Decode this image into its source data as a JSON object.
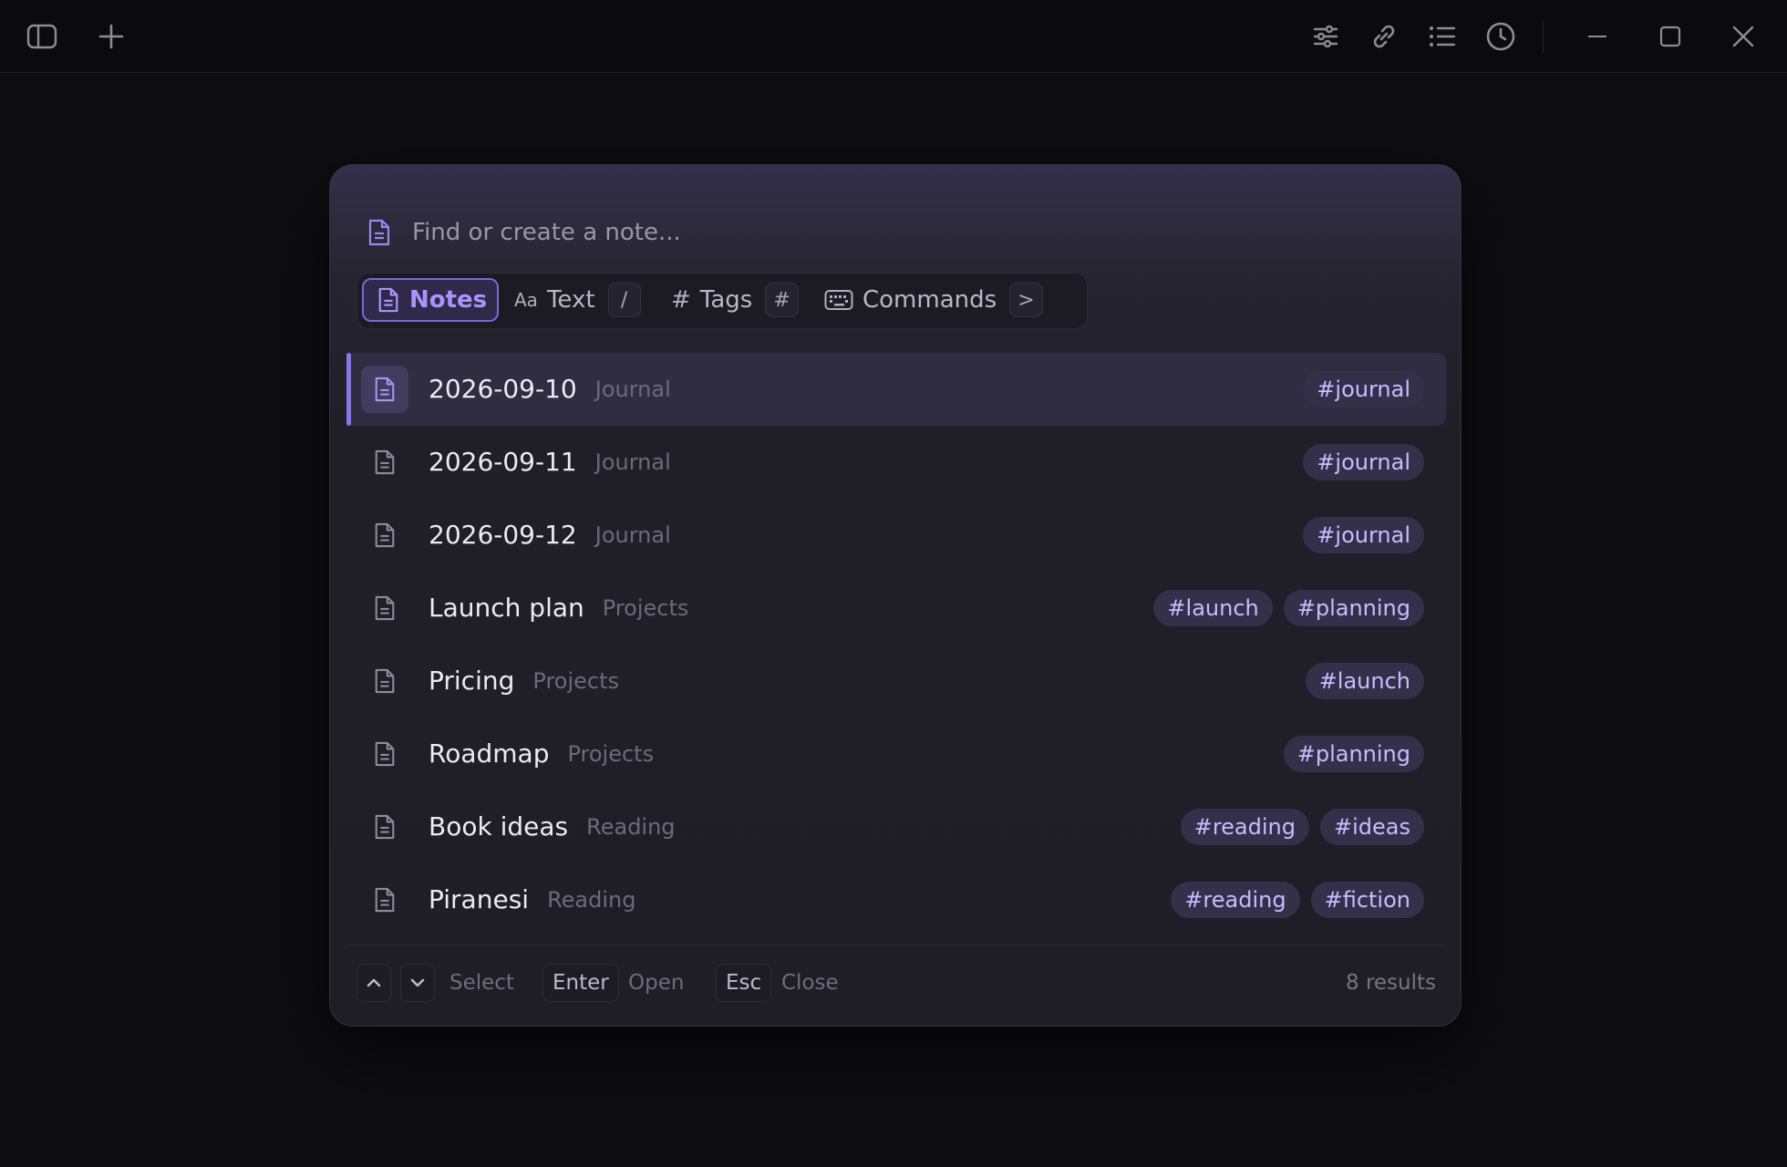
{
  "toolbar": {
    "left_icons": [
      "sidebar-toggle-icon",
      "plus-icon"
    ],
    "right_icons": [
      "sliders-icon",
      "link-icon",
      "list-icon",
      "clock-icon"
    ],
    "window_controls": [
      "minimize-icon",
      "maximize-icon",
      "close-icon"
    ]
  },
  "search": {
    "placeholder": "Find or create a note...",
    "value": ""
  },
  "filters": [
    {
      "label": "Notes",
      "icon": "document-icon",
      "key": "",
      "active": true
    },
    {
      "label": "Text",
      "icon": "Aa",
      "key": "/",
      "active": false
    },
    {
      "label": "Tags",
      "icon": "#",
      "key": "#",
      "active": false
    },
    {
      "label": "Commands",
      "icon": "keyboard-icon",
      "key": ">",
      "active": false
    }
  ],
  "results": [
    {
      "title": "2026-09-10",
      "folder": "Journal",
      "tags": [
        "#journal"
      ],
      "selected": true
    },
    {
      "title": "2026-09-11",
      "folder": "Journal",
      "tags": [
        "#journal"
      ]
    },
    {
      "title": "2026-09-12",
      "folder": "Journal",
      "tags": [
        "#journal"
      ]
    },
    {
      "title": "Launch plan",
      "folder": "Projects",
      "tags": [
        "#launch",
        "#planning"
      ]
    },
    {
      "title": "Pricing",
      "folder": "Projects",
      "tags": [
        "#launch"
      ]
    },
    {
      "title": "Roadmap",
      "folder": "Projects",
      "tags": [
        "#planning"
      ]
    },
    {
      "title": "Book ideas",
      "folder": "Reading",
      "tags": [
        "#reading",
        "#ideas"
      ]
    },
    {
      "title": "Piranesi",
      "folder": "Reading",
      "tags": [
        "#reading",
        "#fiction"
      ]
    }
  ],
  "footer": {
    "select_label": "Select",
    "enter_key": "Enter",
    "open_label": "Open",
    "esc_key": "Esc",
    "close_label": "Close",
    "count": "8 results"
  },
  "colors": {
    "accent": "#8a74ea",
    "tag_bg": "#34304a",
    "tag_text": "#c8bcff",
    "background": "#0e0e11"
  }
}
